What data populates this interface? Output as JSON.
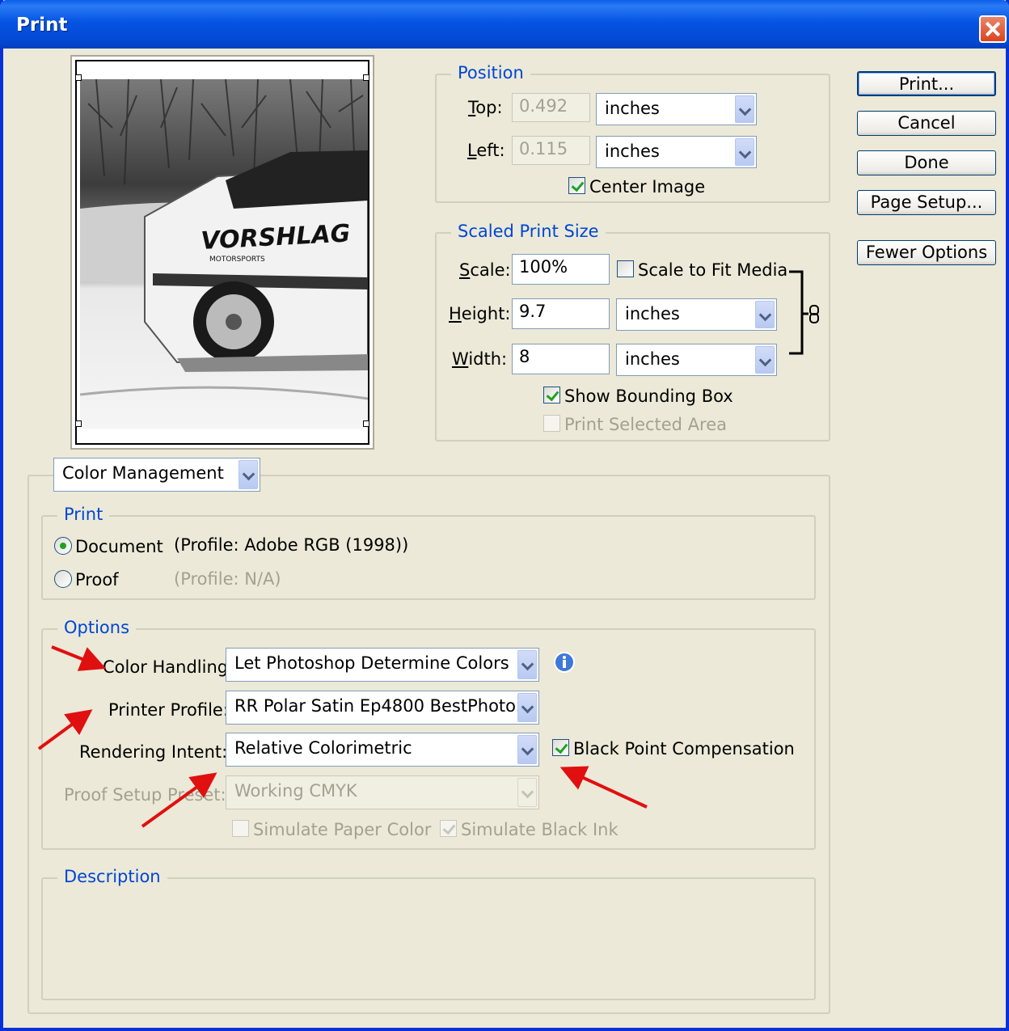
{
  "window": {
    "title": "Print"
  },
  "buttons": {
    "print": "Print...",
    "cancel": "Cancel",
    "done": "Done",
    "page_setup": "Page Setup...",
    "fewer_options": "Fewer Options"
  },
  "position": {
    "legend": "Position",
    "top_label": "Top:",
    "top_value": "0.492",
    "top_unit": "inches",
    "left_label": "Left:",
    "left_value": "0.115",
    "left_unit": "inches",
    "center_image_label": "Center Image",
    "center_image_checked": true
  },
  "scaled": {
    "legend": "Scaled Print Size",
    "scale_label": "Scale:",
    "scale_value": "100%",
    "scale_to_fit_label": "Scale to Fit Media",
    "scale_to_fit_checked": false,
    "height_label": "Height:",
    "height_value": "9.7",
    "height_unit": "inches",
    "width_label": "Width:",
    "width_value": "8",
    "width_unit": "inches",
    "show_bounding_label": "Show Bounding Box",
    "show_bounding_checked": true,
    "print_selected_label": "Print Selected Area",
    "print_selected_checked": false
  },
  "section_select": {
    "value": "Color Management"
  },
  "print_group": {
    "legend": "Print",
    "document_label": "Document",
    "document_profile": "(Profile: Adobe RGB (1998))",
    "document_selected": true,
    "proof_label": "Proof",
    "proof_profile": "(Profile: N/A)"
  },
  "options": {
    "legend": "Options",
    "color_handling_label": "Color Handling:",
    "color_handling_value": "Let Photoshop Determine Colors",
    "printer_profile_label": "Printer Profile:",
    "printer_profile_value": "RR Polar Satin Ep4800 BestPhoto...",
    "rendering_intent_label": "Rendering Intent:",
    "rendering_intent_value": "Relative Colorimetric",
    "black_point_label": "Black Point Compensation",
    "black_point_checked": true,
    "proof_setup_label": "Proof Setup Preset:",
    "proof_setup_value": "Working CMYK",
    "simulate_paper_label": "Simulate Paper Color",
    "simulate_paper_checked": false,
    "simulate_black_label": "Simulate Black Ink",
    "simulate_black_checked": true
  },
  "description": {
    "legend": "Description"
  },
  "preview": {
    "logo_text": "VORSHLAG",
    "logo_sub": "MOTORSPORTS"
  },
  "colors": {
    "title_blue": "#0554e3",
    "dialog_bg": "#ece9d8",
    "legend_blue": "#0046d5",
    "annotation_red": "#e01010"
  }
}
